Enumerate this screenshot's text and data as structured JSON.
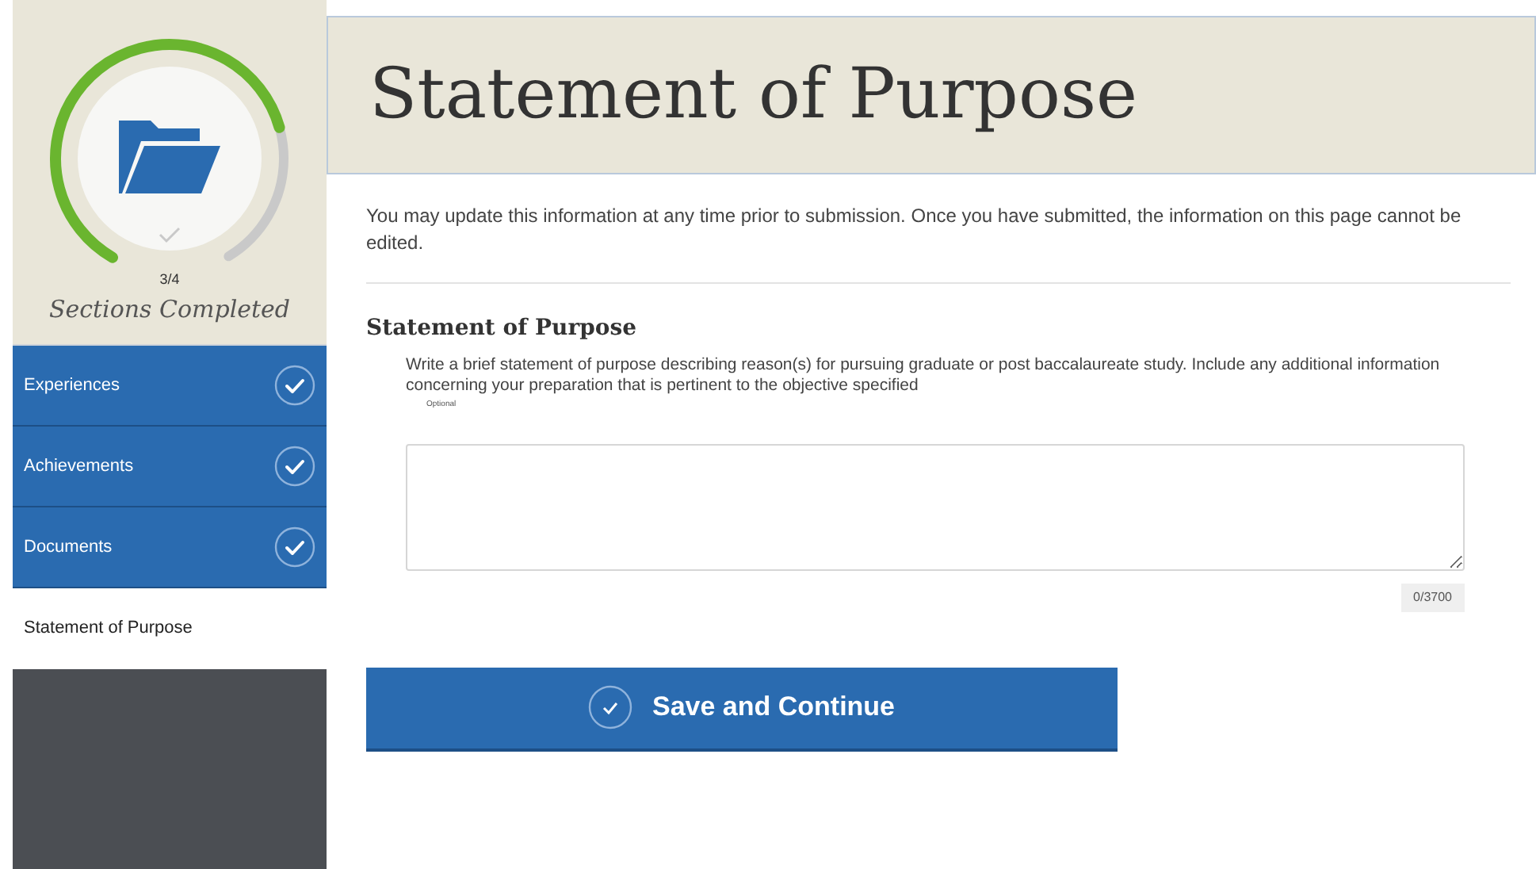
{
  "progress": {
    "count": "3/4",
    "label": "Sections Completed",
    "level": 0.75
  },
  "sidebar": {
    "items": [
      {
        "label": "Experiences",
        "completed": true,
        "selected": false
      },
      {
        "label": "Achievements",
        "completed": true,
        "selected": false
      },
      {
        "label": "Documents",
        "completed": true,
        "selected": false
      },
      {
        "label": "Statement of Purpose",
        "completed": false,
        "selected": true
      }
    ]
  },
  "header": {
    "title": "Statement of Purpose"
  },
  "notice": "You may update this information at any time prior to submission. Once you have submitted, the information on this page cannot be edited.",
  "section": {
    "title": "Statement of Purpose",
    "description": "Write a brief statement of purpose describing reason(s) for pursuing graduate or post baccalaureate study. Include any additional information concerning your preparation that is pertinent to the objective specified",
    "optional": "Optional",
    "counter": "0/3700"
  },
  "button": {
    "label": "Save and Continue"
  }
}
